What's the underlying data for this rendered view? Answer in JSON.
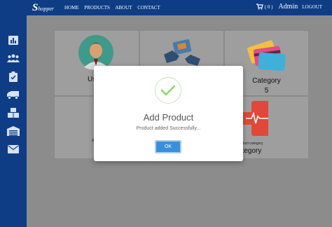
{
  "navbar": {
    "brand_initial": "S",
    "brand_rest": "hopper",
    "links": [
      "HOME",
      "PRODUCTS",
      "ABOUT",
      "CONTACT"
    ],
    "cart_count": "( 0 )",
    "admin_label": "Admin",
    "logout_label": "LOGOUT"
  },
  "sidebar": {
    "icons": [
      "chart-icon",
      "users-icon",
      "clipboard-check-icon",
      "truck-icon",
      "boxes-icon",
      "warehouse-icon",
      "envelope-icon"
    ]
  },
  "dashboard": {
    "cards": [
      {
        "label": "Us",
        "value": "",
        "sub": ""
      },
      {
        "label": "",
        "value": "",
        "sub": ""
      },
      {
        "label": "Category",
        "value": "5",
        "sub": ""
      },
      {
        "label": "",
        "value": "",
        "sub": "Ac"
      },
      {
        "label": "",
        "value": "",
        "sub": ""
      },
      {
        "label": "ategory",
        "value": "",
        "sub": "roduct category"
      }
    ]
  },
  "modal": {
    "title": "Add Product",
    "message": "Product added Successfully...",
    "ok_label": "OK"
  },
  "colors": {
    "navbar": "#0e3d86",
    "accent_button": "#3a8fd9",
    "success_check": "#8cd466"
  }
}
